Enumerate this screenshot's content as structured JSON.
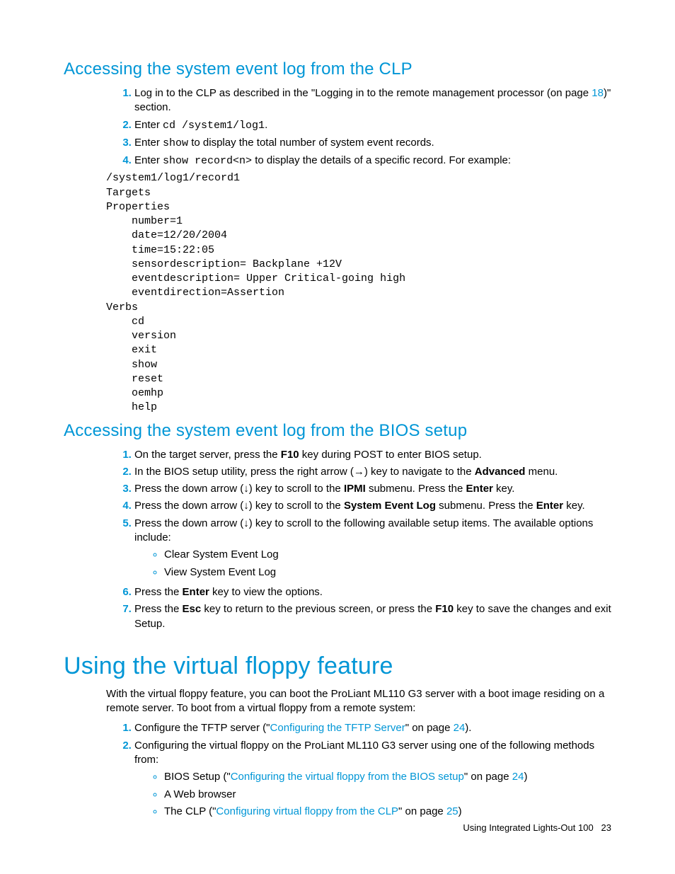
{
  "section1": {
    "heading": "Accessing the system event log from the CLP",
    "step1_a": "Log in to the CLP as described in the \"Logging in to the remote management processor (on page ",
    "step1_link": "18",
    "step1_b": ")\" section.",
    "step2_a": "Enter ",
    "step2_code": "cd /system1/log1",
    "step2_b": ".",
    "step3_a": "Enter ",
    "step3_code": "show",
    "step3_b": " to display the total number of system event records.",
    "step4_a": "Enter ",
    "step4_code": "show record<n>",
    "step4_b": " to display the details of a specific record. For example:",
    "code": "/system1/log1/record1\nTargets\nProperties\n    number=1\n    date=12/20/2004\n    time=15:22:05\n    sensordescription= Backplane +12V\n    eventdescription= Upper Critical-going high\n    eventdirection=Assertion\nVerbs\n    cd\n    version\n    exit\n    show\n    reset\n    oemhp\n    help"
  },
  "section2": {
    "heading": "Accessing the system event log from the BIOS setup",
    "step1_a": "On the target server, press the ",
    "step1_b": "F10",
    "step1_c": " key during POST to enter BIOS setup.",
    "step2_a": "In the BIOS setup utility, press the right arrow (→) key to navigate to the ",
    "step2_b": "Advanced",
    "step2_c": " menu.",
    "step3_a": "Press the down arrow (↓) key to scroll to the ",
    "step3_b": "IPMI",
    "step3_c": " submenu. Press the ",
    "step3_d": "Enter",
    "step3_e": " key.",
    "step4_a": "Press the down arrow (↓) key to scroll to the ",
    "step4_b": "System Event Log",
    "step4_c": " submenu. Press the ",
    "step4_d": "Enter",
    "step4_e": " key.",
    "step5": "Press the down arrow (↓) key to scroll to the following available setup items. The available options include:",
    "step5_bullets": [
      "Clear System Event Log",
      "View System Event Log"
    ],
    "step6_a": "Press the ",
    "step6_b": "Enter",
    "step6_c": " key to view the options.",
    "step7_a": "Press the ",
    "step7_b": "Esc",
    "step7_c": " key to return to the previous screen, or press the ",
    "step7_d": "F10",
    "step7_e": " key to save the changes and exit Setup."
  },
  "section3": {
    "heading": "Using the virtual floppy feature",
    "intro": "With the virtual floppy feature, you can boot the ProLiant ML110 G3 server with a boot image residing on a remote server. To boot from a virtual floppy from a remote system:",
    "step1_a": "Configure the TFTP server (\"",
    "step1_link": "Configuring the TFTP Server",
    "step1_b": "\" on page ",
    "step1_page": "24",
    "step1_c": ").",
    "step2": "Configuring the virtual floppy on the ProLiant ML110 G3 server using one of the following methods from:",
    "b1_a": "BIOS Setup (\"",
    "b1_link": "Configuring the virtual floppy from the BIOS setup",
    "b1_b": "\" on page ",
    "b1_page": "24",
    "b1_c": ")",
    "b2": "A Web browser",
    "b3_a": "The CLP (\"",
    "b3_link": "Configuring virtual floppy from the CLP",
    "b3_b": "\" on page ",
    "b3_page": "25",
    "b3_c": ")"
  },
  "footer": {
    "text": "Using Integrated Lights-Out 100",
    "page": "23"
  }
}
